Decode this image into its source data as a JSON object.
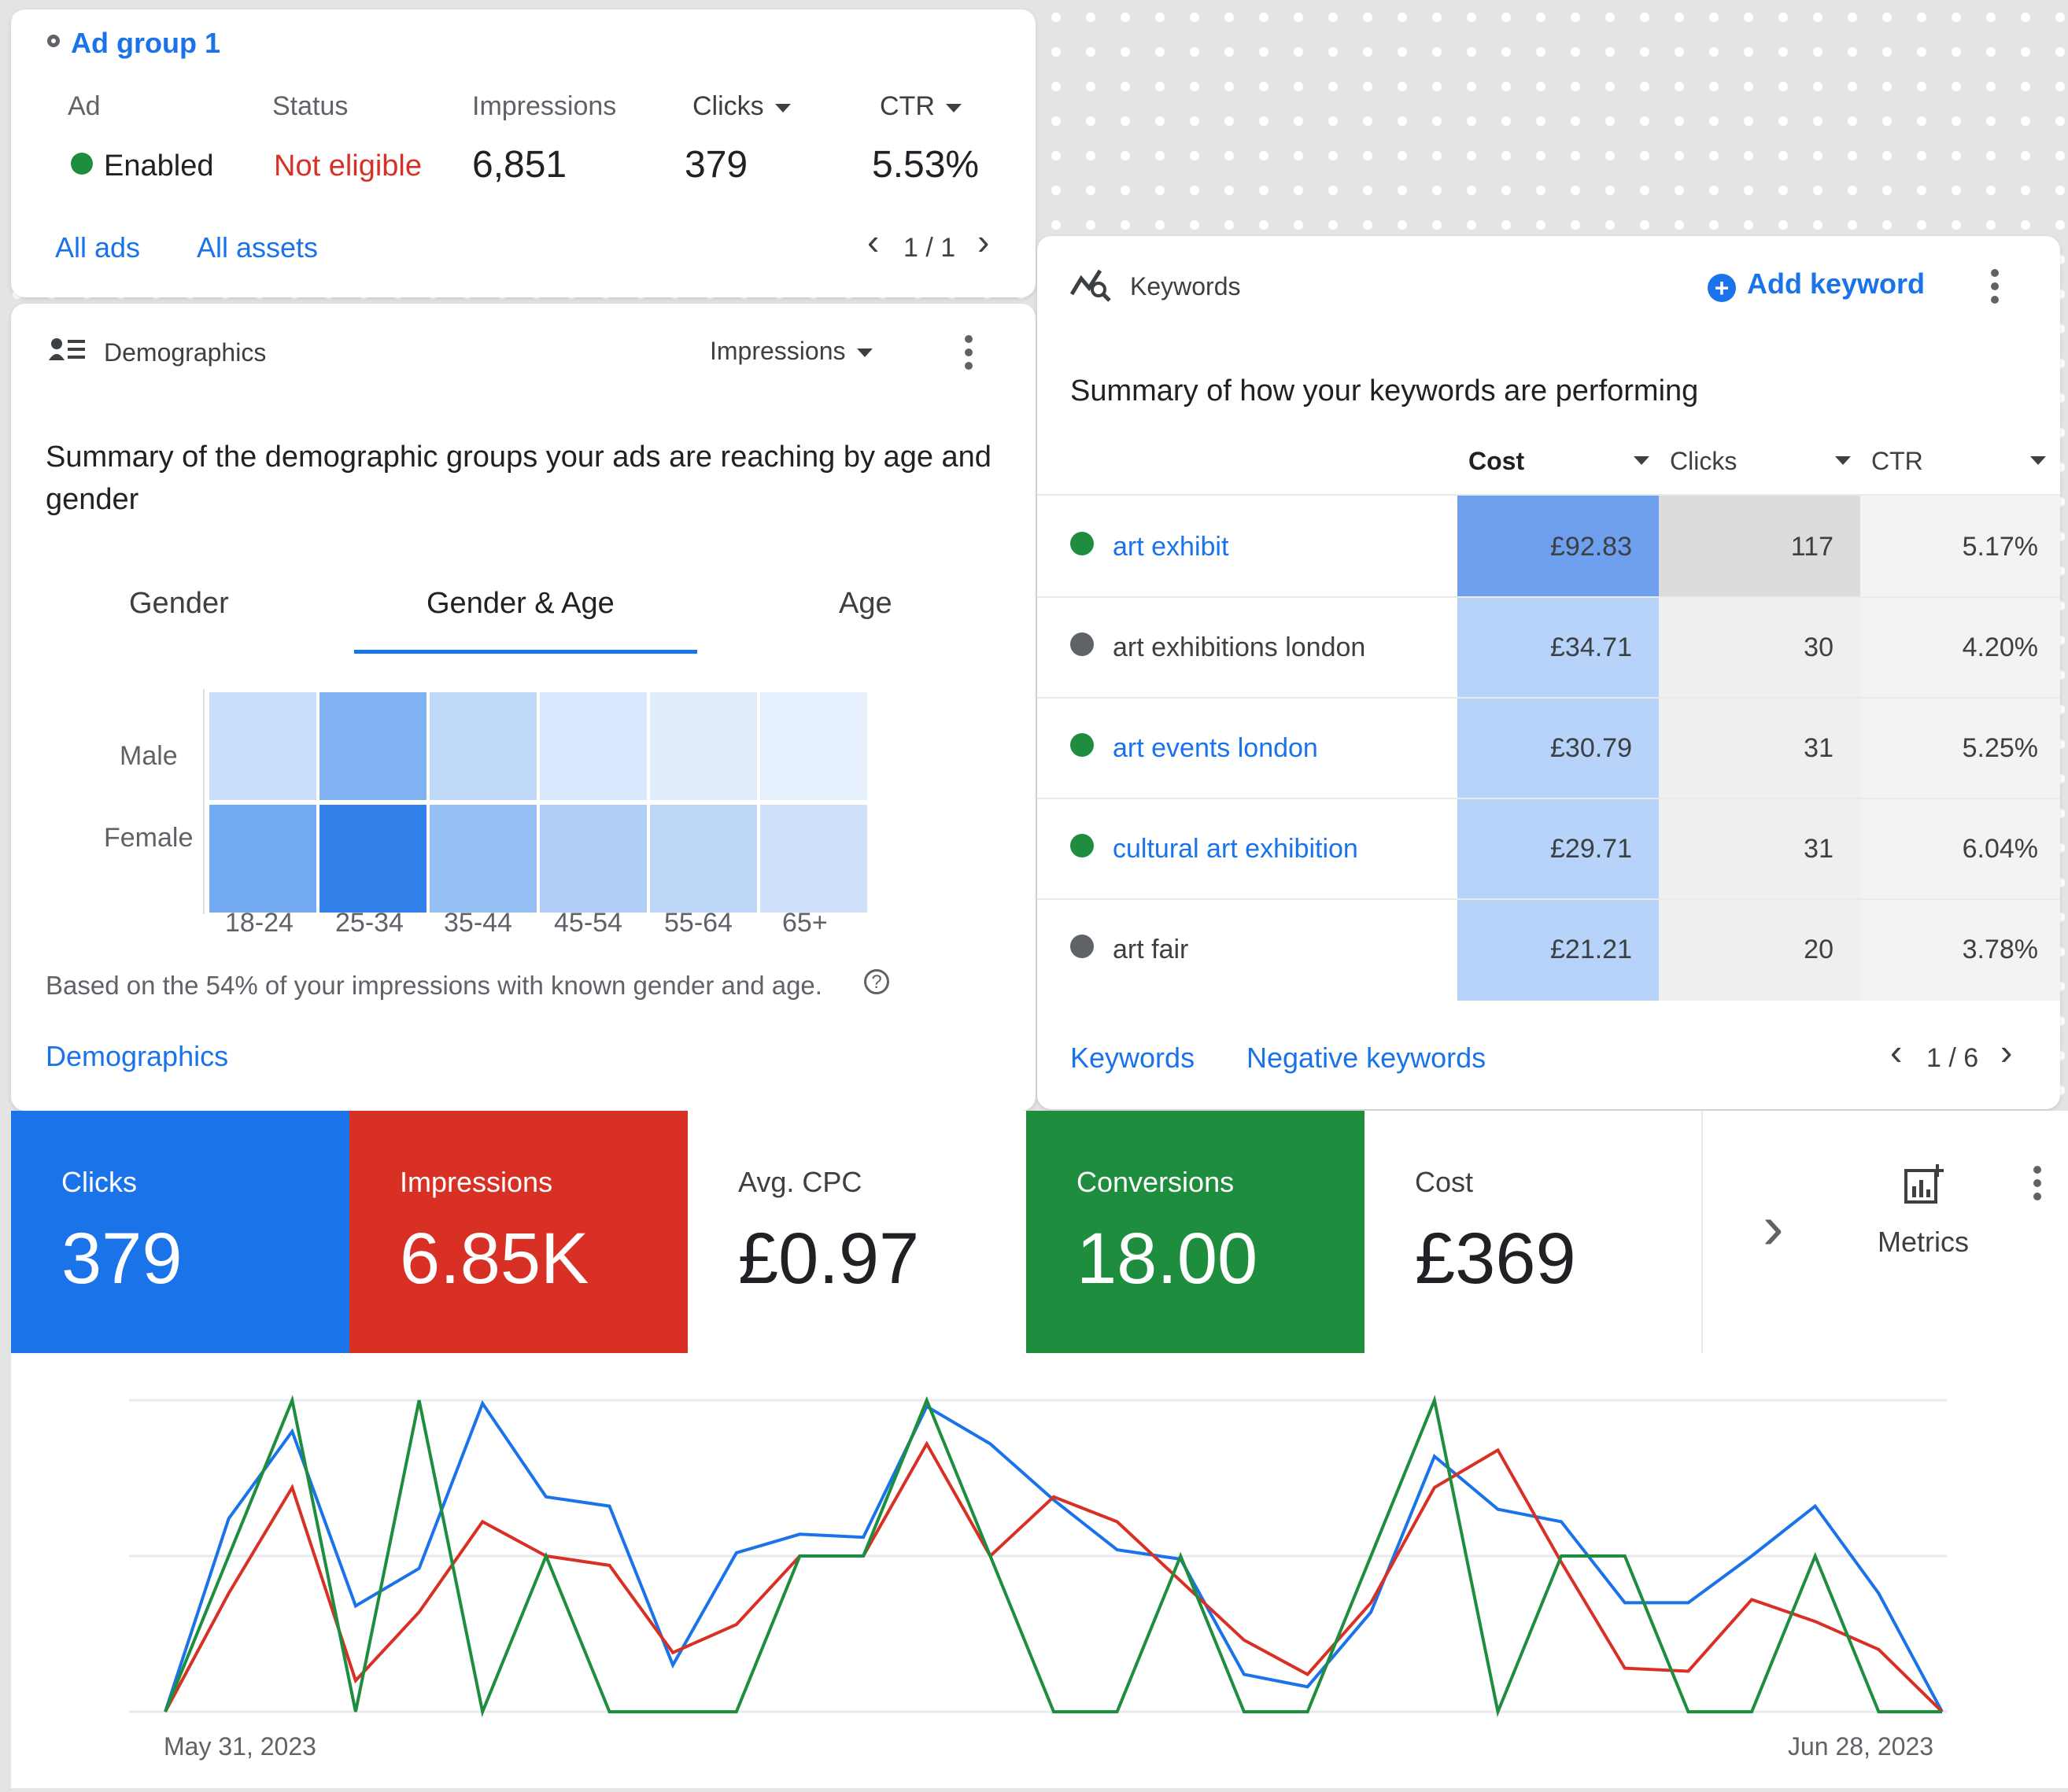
{
  "ad_group": {
    "title": "Ad group 1",
    "headers": {
      "ad": "Ad",
      "status": "Status",
      "impressions": "Impressions",
      "clicks": "Clicks",
      "ctr": "CTR"
    },
    "row": {
      "ad": "Enabled",
      "status": "Not eligible",
      "impressions": "6,851",
      "clicks": "379",
      "ctr": "5.53%"
    },
    "links": {
      "all_ads": "All ads",
      "all_assets": "All assets"
    },
    "pager": "1 / 1"
  },
  "demographics": {
    "title": "Demographics",
    "metric_dropdown": "Impressions",
    "summary": "Summary of the demographic groups your ads are reaching by age and gender",
    "tabs": [
      "Gender",
      "Gender & Age",
      "Age"
    ],
    "active_tab": 1,
    "rows": [
      "Male",
      "Female"
    ],
    "columns": [
      "18-24",
      "25-34",
      "35-44",
      "45-54",
      "55-64",
      "65+"
    ],
    "heatmap_intensity": {
      "Male": [
        0.18,
        0.55,
        0.22,
        0.1,
        0.06,
        0.03
      ],
      "Female": [
        0.62,
        0.95,
        0.45,
        0.3,
        0.25,
        0.15
      ]
    },
    "footnote": "Based on the 54% of your impressions with known gender and age.",
    "link": "Demographics"
  },
  "keywords": {
    "title": "Keywords",
    "add_button": "Add keyword",
    "summary": "Summary of how your keywords are performing",
    "columns": [
      "Cost",
      "Clicks",
      "CTR"
    ],
    "rows": [
      {
        "keyword": "art exhibit",
        "status": "enabled",
        "cost": "£92.83",
        "clicks": "117",
        "ctr": "5.17%"
      },
      {
        "keyword": "art exhibitions london",
        "status": "paused",
        "cost": "£34.71",
        "clicks": "30",
        "ctr": "4.20%"
      },
      {
        "keyword": "art events london",
        "status": "enabled",
        "cost": "£30.79",
        "clicks": "31",
        "ctr": "5.25%"
      },
      {
        "keyword": "cultural art exhibition",
        "status": "enabled",
        "cost": "£29.71",
        "clicks": "31",
        "ctr": "6.04%"
      },
      {
        "keyword": "art fair",
        "status": "paused",
        "cost": "£21.21",
        "clicks": "20",
        "ctr": "3.78%"
      }
    ],
    "links": {
      "keywords": "Keywords",
      "negative_keywords": "Negative keywords"
    },
    "pager": "1 / 6"
  },
  "metrics": {
    "tiles": [
      {
        "label": "Clicks",
        "value": "379",
        "color": "#1a73e8"
      },
      {
        "label": "Impressions",
        "value": "6.85K",
        "color": "#d93025"
      },
      {
        "label": "Avg. CPC",
        "value": "£0.97",
        "color": "#ffffff"
      },
      {
        "label": "Conversions",
        "value": "18.00",
        "color": "#1e8e3e"
      },
      {
        "label": "Cost",
        "value": "£369",
        "color": "#ffffff"
      }
    ],
    "metrics_button": "Metrics"
  },
  "chart_data": {
    "type": "line",
    "x_labels": [
      "May 31, 2023",
      "Jun 28, 2023"
    ],
    "series": [
      {
        "color": "#1a73e8",
        "values": [
          0,
          0.62,
          0.9,
          0.34,
          0.46,
          0.99,
          0.69,
          0.66,
          0.15,
          0.51,
          0.57,
          0.56,
          0.98,
          0.86,
          0.68,
          0.52,
          0.49,
          0.12,
          0.08,
          0.32,
          0.82,
          0.65,
          0.61,
          0.35,
          0.35,
          0.5,
          0.66,
          0.38,
          0
        ]
      },
      {
        "color": "#d93025",
        "values": [
          0,
          0.38,
          0.72,
          0.1,
          0.32,
          0.61,
          0.5,
          0.47,
          0.19,
          0.28,
          0.5,
          0.5,
          0.86,
          0.5,
          0.69,
          0.61,
          0.42,
          0.23,
          0.12,
          0.35,
          0.72,
          0.84,
          0.48,
          0.14,
          0.13,
          0.36,
          0.29,
          0.2,
          0
        ]
      },
      {
        "color": "#1e8e3e",
        "values": [
          0,
          0.5,
          1.0,
          0,
          1.0,
          0,
          0.5,
          0,
          0,
          0,
          0.5,
          0.5,
          1.0,
          0.5,
          0,
          0,
          0.5,
          0,
          0,
          0.5,
          1.0,
          0,
          0.5,
          0.5,
          0,
          0,
          0.5,
          0,
          0
        ]
      }
    ]
  }
}
